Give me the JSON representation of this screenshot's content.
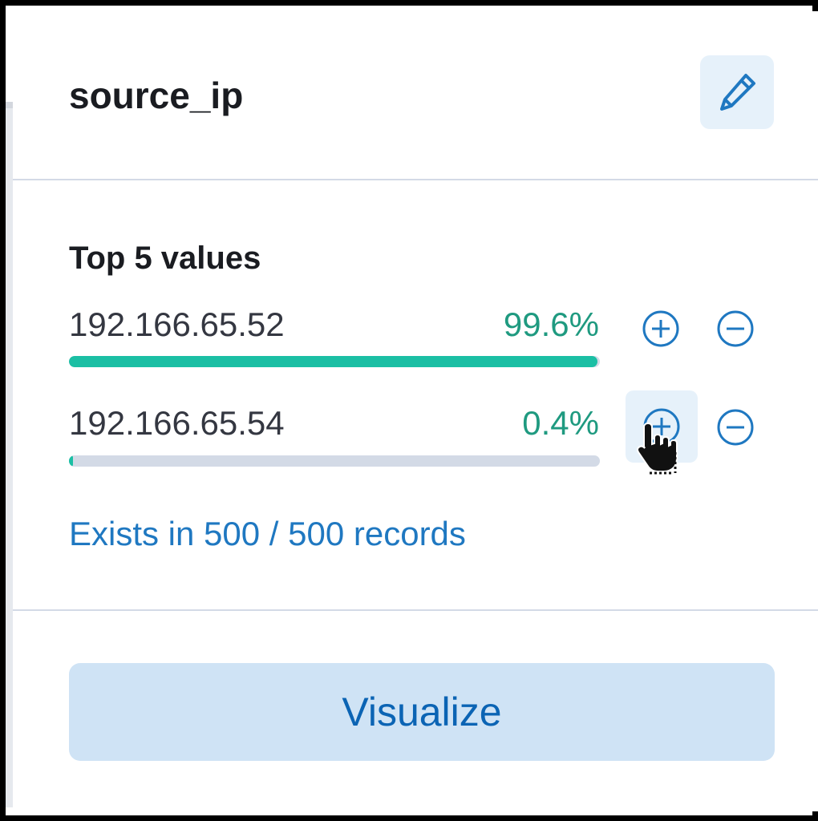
{
  "field_popover": {
    "title": "source_ip",
    "edit_icon": "pencil-icon",
    "section_heading": "Top 5 values",
    "values": [
      {
        "label": "192.166.65.52",
        "percent": "99.6%",
        "fraction": 0.996
      },
      {
        "label": "192.166.65.54",
        "percent": "0.4%",
        "fraction": 0.004
      }
    ],
    "filter_in_icon": "plus-circle-icon",
    "filter_out_icon": "minus-circle-icon",
    "exists_text": "Exists in 500 / 500 records",
    "visualize_label": "Visualize"
  },
  "colors": {
    "accent_bar": "#1bbfa4",
    "percent_text": "#1f9a80",
    "link": "#1f78c1",
    "icon": "#1f78c1",
    "button_bg": "#cfe3f5",
    "button_text": "#0b64b4"
  }
}
